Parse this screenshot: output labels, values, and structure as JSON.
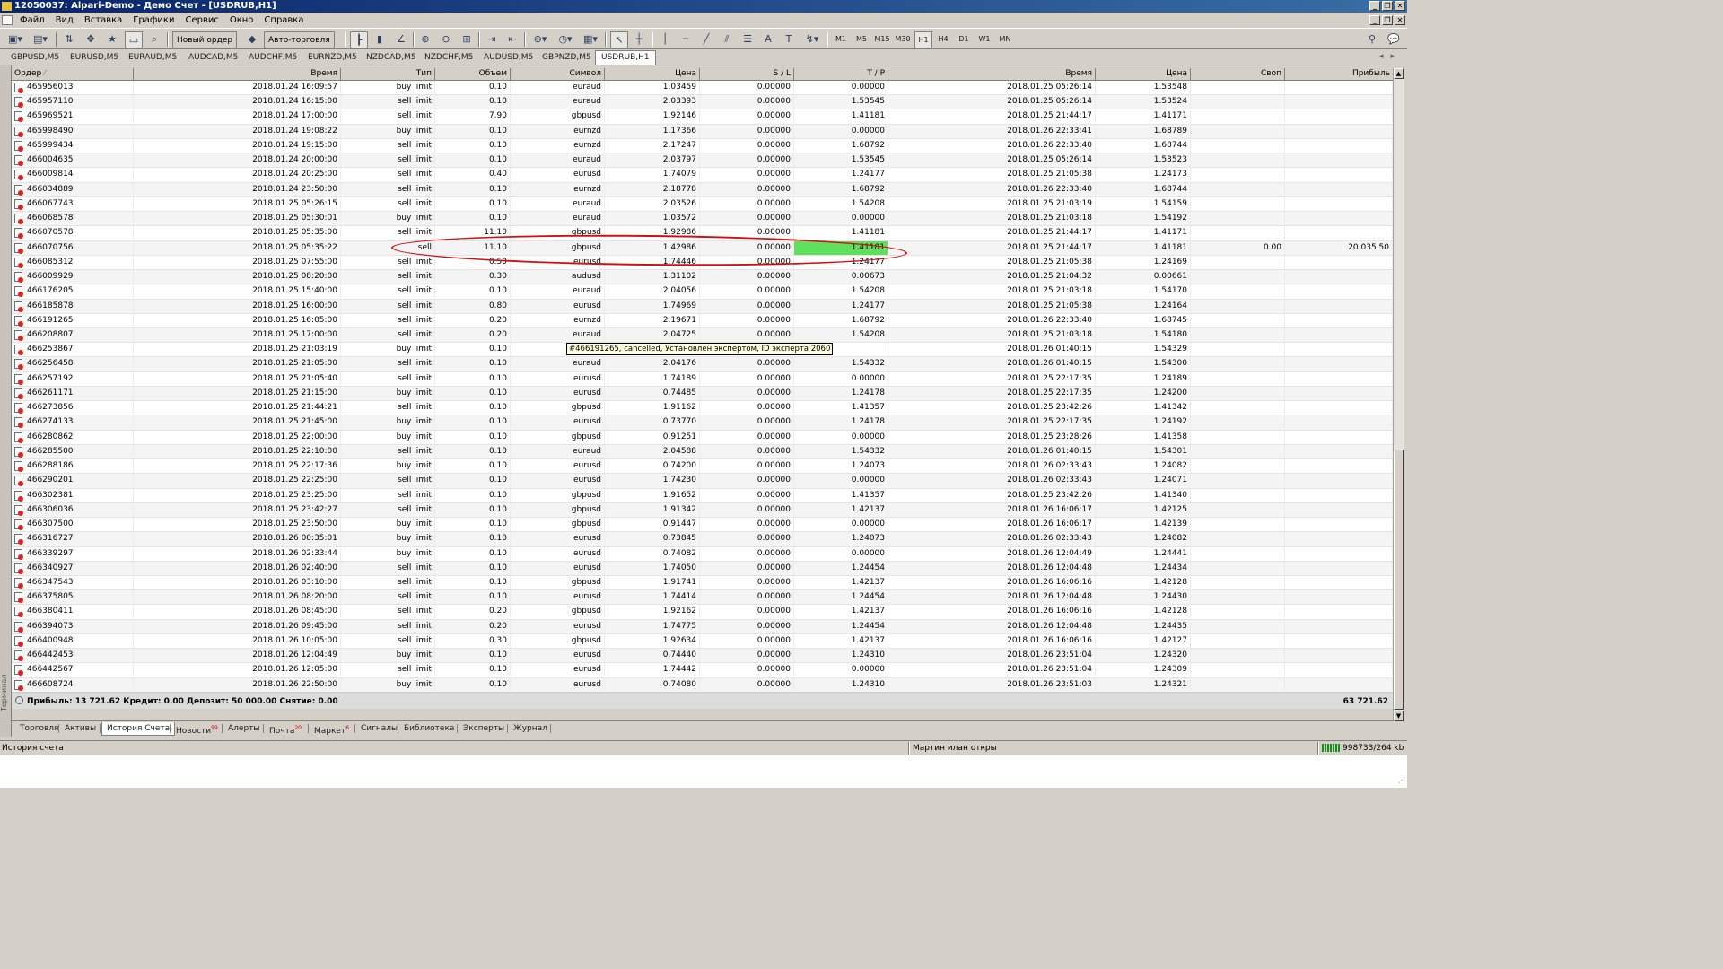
{
  "window": {
    "title": "12050037: Alpari-Demo - Демо Счет - [USDRUB,H1]"
  },
  "menu": [
    "Файл",
    "Вид",
    "Вставка",
    "Графики",
    "Сервис",
    "Окно",
    "Справка"
  ],
  "toolbar": {
    "new_order_label": "Новый ордер",
    "autotrade_label": "Авто-торговля",
    "timeframes": [
      "M1",
      "M5",
      "M15",
      "M30",
      "H1",
      "H4",
      "D1",
      "W1",
      "MN"
    ],
    "active_timeframe": "H1"
  },
  "chart_tabs": [
    "GBPUSD,M5",
    "EURUSD,M5",
    "EURAUD,M5",
    "AUDCAD,M5",
    "AUDCHF,M5",
    "EURNZD,M5",
    "NZDCAD,M5",
    "NZDCHF,M5",
    "AUDUSD,M5",
    "GBPNZD,M5",
    "USDRUB,H1"
  ],
  "active_chart_tab": "USDRUB,H1",
  "columns": [
    "Ордер",
    "Время",
    "Тип",
    "Объем",
    "Символ",
    "Цена",
    "S / L",
    "T / P",
    "Время",
    "Цена",
    "Своп",
    "Прибыль"
  ],
  "rows": [
    [
      "465956013",
      "2018.01.24 16:09:57",
      "buy limit",
      "0.10",
      "euraud",
      "1.03459",
      "0.00000",
      "0.00000",
      "2018.01.25 05:26:14",
      "1.53548",
      "",
      ""
    ],
    [
      "465957110",
      "2018.01.24 16:15:00",
      "sell limit",
      "0.10",
      "euraud",
      "2.03393",
      "0.00000",
      "1.53545",
      "2018.01.25 05:26:14",
      "1.53524",
      "",
      ""
    ],
    [
      "465969521",
      "2018.01.24 17:00:00",
      "sell limit",
      "7.90",
      "gbpusd",
      "1.92146",
      "0.00000",
      "1.41181",
      "2018.01.25 21:44:17",
      "1.41171",
      "",
      ""
    ],
    [
      "465998490",
      "2018.01.24 19:08:22",
      "buy limit",
      "0.10",
      "eurnzd",
      "1.17366",
      "0.00000",
      "0.00000",
      "2018.01.26 22:33:41",
      "1.68789",
      "",
      ""
    ],
    [
      "465999434",
      "2018.01.24 19:15:00",
      "sell limit",
      "0.10",
      "eurnzd",
      "2.17247",
      "0.00000",
      "1.68792",
      "2018.01.26 22:33:40",
      "1.68744",
      "",
      ""
    ],
    [
      "466004635",
      "2018.01.24 20:00:00",
      "sell limit",
      "0.10",
      "euraud",
      "2.03797",
      "0.00000",
      "1.53545",
      "2018.01.25 05:26:14",
      "1.53523",
      "",
      ""
    ],
    [
      "466009814",
      "2018.01.24 20:25:00",
      "sell limit",
      "0.40",
      "eurusd",
      "1.74079",
      "0.00000",
      "1.24177",
      "2018.01.25 21:05:38",
      "1.24173",
      "",
      ""
    ],
    [
      "466034889",
      "2018.01.24 23:50:00",
      "sell limit",
      "0.10",
      "eurnzd",
      "2.18778",
      "0.00000",
      "1.68792",
      "2018.01.26 22:33:40",
      "1.68744",
      "",
      ""
    ],
    [
      "466067743",
      "2018.01.25 05:26:15",
      "sell limit",
      "0.10",
      "euraud",
      "2.03526",
      "0.00000",
      "1.54208",
      "2018.01.25 21:03:19",
      "1.54159",
      "",
      ""
    ],
    [
      "466068578",
      "2018.01.25 05:30:01",
      "buy limit",
      "0.10",
      "euraud",
      "1.03572",
      "0.00000",
      "0.00000",
      "2018.01.25 21:03:18",
      "1.54192",
      "",
      ""
    ],
    [
      "466070578",
      "2018.01.25 05:35:00",
      "sell limit",
      "11.10",
      "gbpusd",
      "1.92986",
      "0.00000",
      "1.41181",
      "2018.01.25 21:44:17",
      "1.41171",
      "",
      ""
    ],
    [
      "466070756",
      "2018.01.25 05:35:22",
      "sell",
      "11.10",
      "gbpusd",
      "1.42986",
      "0.00000",
      "1.41181",
      "2018.01.25 21:44:17",
      "1.41181",
      "0.00",
      "20 035.50"
    ],
    [
      "466085312",
      "2018.01.25 07:55:00",
      "sell limit",
      "0.50",
      "eurusd",
      "1.74446",
      "0.00000",
      "1.24177",
      "2018.01.25 21:05:38",
      "1.24169",
      "",
      ""
    ],
    [
      "466009929",
      "2018.01.25 08:20:00",
      "sell limit",
      "0.30",
      "audusd",
      "1.31102",
      "0.00000",
      "0.00673",
      "2018.01.25 21:04:32",
      "0.00661",
      "",
      ""
    ],
    [
      "466176205",
      "2018.01.25 15:40:00",
      "sell limit",
      "0.10",
      "euraud",
      "2.04056",
      "0.00000",
      "1.54208",
      "2018.01.25 21:03:18",
      "1.54170",
      "",
      ""
    ],
    [
      "466185878",
      "2018.01.25 16:00:00",
      "sell limit",
      "0.80",
      "eurusd",
      "1.74969",
      "0.00000",
      "1.24177",
      "2018.01.25 21:05:38",
      "1.24164",
      "",
      ""
    ],
    [
      "466191265",
      "2018.01.25 16:05:00",
      "sell limit",
      "0.20",
      "eurnzd",
      "2.19671",
      "0.00000",
      "1.68792",
      "2018.01.26 22:33:40",
      "1.68745",
      "",
      ""
    ],
    [
      "466208807",
      "2018.01.25 17:00:00",
      "sell limit",
      "0.20",
      "euraud",
      "2.04725",
      "0.00000",
      "1.54208",
      "2018.01.25 21:03:18",
      "1.54180",
      "",
      ""
    ],
    [
      "466253867",
      "2018.01.25 21:03:19",
      "buy limit",
      "0.10",
      "",
      "",
      "",
      "",
      "2018.01.26 01:40:15",
      "1.54329",
      "",
      ""
    ],
    [
      "466256458",
      "2018.01.25 21:05:00",
      "sell limit",
      "0.10",
      "euraud",
      "2.04176",
      "0.00000",
      "1.54332",
      "2018.01.26 01:40:15",
      "1.54300",
      "",
      ""
    ],
    [
      "466257192",
      "2018.01.25 21:05:40",
      "sell limit",
      "0.10",
      "eurusd",
      "1.74189",
      "0.00000",
      "0.00000",
      "2018.01.25 22:17:35",
      "1.24189",
      "",
      ""
    ],
    [
      "466261171",
      "2018.01.25 21:15:00",
      "buy limit",
      "0.10",
      "eurusd",
      "0.74485",
      "0.00000",
      "1.24178",
      "2018.01.25 22:17:35",
      "1.24200",
      "",
      ""
    ],
    [
      "466273856",
      "2018.01.25 21:44:21",
      "sell limit",
      "0.10",
      "gbpusd",
      "1.91162",
      "0.00000",
      "1.41357",
      "2018.01.25 23:42:26",
      "1.41342",
      "",
      ""
    ],
    [
      "466274133",
      "2018.01.25 21:45:00",
      "buy limit",
      "0.10",
      "eurusd",
      "0.73770",
      "0.00000",
      "1.24178",
      "2018.01.25 22:17:35",
      "1.24192",
      "",
      ""
    ],
    [
      "466280862",
      "2018.01.25 22:00:00",
      "buy limit",
      "0.10",
      "gbpusd",
      "0.91251",
      "0.00000",
      "0.00000",
      "2018.01.25 23:28:26",
      "1.41358",
      "",
      ""
    ],
    [
      "466285500",
      "2018.01.25 22:10:00",
      "sell limit",
      "0.10",
      "euraud",
      "2.04588",
      "0.00000",
      "1.54332",
      "2018.01.26 01:40:15",
      "1.54301",
      "",
      ""
    ],
    [
      "466288186",
      "2018.01.25 22:17:36",
      "buy limit",
      "0.10",
      "eurusd",
      "0.74200",
      "0.00000",
      "1.24073",
      "2018.01.26 02:33:43",
      "1.24082",
      "",
      ""
    ],
    [
      "466290201",
      "2018.01.25 22:25:00",
      "sell limit",
      "0.10",
      "eurusd",
      "1.74230",
      "0.00000",
      "0.00000",
      "2018.01.26 02:33:43",
      "1.24071",
      "",
      ""
    ],
    [
      "466302381",
      "2018.01.25 23:25:00",
      "sell limit",
      "0.10",
      "gbpusd",
      "1.91652",
      "0.00000",
      "1.41357",
      "2018.01.25 23:42:26",
      "1.41340",
      "",
      ""
    ],
    [
      "466306036",
      "2018.01.25 23:42:27",
      "sell limit",
      "0.10",
      "gbpusd",
      "1.91342",
      "0.00000",
      "1.42137",
      "2018.01.26 16:06:17",
      "1.42125",
      "",
      ""
    ],
    [
      "466307500",
      "2018.01.25 23:50:00",
      "buy limit",
      "0.10",
      "gbpusd",
      "0.91447",
      "0.00000",
      "0.00000",
      "2018.01.26 16:06:17",
      "1.42139",
      "",
      ""
    ],
    [
      "466316727",
      "2018.01.26 00:35:01",
      "buy limit",
      "0.10",
      "eurusd",
      "0.73845",
      "0.00000",
      "1.24073",
      "2018.01.26 02:33:43",
      "1.24082",
      "",
      ""
    ],
    [
      "466339297",
      "2018.01.26 02:33:44",
      "buy limit",
      "0.10",
      "eurusd",
      "0.74082",
      "0.00000",
      "0.00000",
      "2018.01.26 12:04:49",
      "1.24441",
      "",
      ""
    ],
    [
      "466340927",
      "2018.01.26 02:40:00",
      "sell limit",
      "0.10",
      "eurusd",
      "1.74050",
      "0.00000",
      "1.24454",
      "2018.01.26 12:04:48",
      "1.24434",
      "",
      ""
    ],
    [
      "466347543",
      "2018.01.26 03:10:00",
      "sell limit",
      "0.10",
      "gbpusd",
      "1.91741",
      "0.00000",
      "1.42137",
      "2018.01.26 16:06:16",
      "1.42128",
      "",
      ""
    ],
    [
      "466375805",
      "2018.01.26 08:20:00",
      "sell limit",
      "0.10",
      "eurusd",
      "1.74414",
      "0.00000",
      "1.24454",
      "2018.01.26 12:04:48",
      "1.24430",
      "",
      ""
    ],
    [
      "466380411",
      "2018.01.26 08:45:00",
      "sell limit",
      "0.20",
      "gbpusd",
      "1.92162",
      "0.00000",
      "1.42137",
      "2018.01.26 16:06:16",
      "1.42128",
      "",
      ""
    ],
    [
      "466394073",
      "2018.01.26 09:45:00",
      "sell limit",
      "0.20",
      "eurusd",
      "1.74775",
      "0.00000",
      "1.24454",
      "2018.01.26 12:04:48",
      "1.24435",
      "",
      ""
    ],
    [
      "466400948",
      "2018.01.26 10:05:00",
      "sell limit",
      "0.30",
      "gbpusd",
      "1.92634",
      "0.00000",
      "1.42137",
      "2018.01.26 16:06:16",
      "1.42127",
      "",
      ""
    ],
    [
      "466442453",
      "2018.01.26 12:04:49",
      "buy limit",
      "0.10",
      "eurusd",
      "0.74440",
      "0.00000",
      "1.24310",
      "2018.01.26 23:51:04",
      "1.24320",
      "",
      ""
    ],
    [
      "466442567",
      "2018.01.26 12:05:00",
      "sell limit",
      "0.10",
      "eurusd",
      "1.74442",
      "0.00000",
      "0.00000",
      "2018.01.26 23:51:04",
      "1.24309",
      "",
      ""
    ],
    [
      "466608724",
      "2018.01.26 22:50:00",
      "buy limit",
      "0.10",
      "eurusd",
      "0.74080",
      "0.00000",
      "1.24310",
      "2018.01.26 23:51:03",
      "1.24321",
      "",
      ""
    ]
  ],
  "highlight_row_index": 11,
  "highlight_color": "#5ee05e",
  "annotation_color": "#d11111",
  "tooltip": "#466191265, cancelled, Установлен экспертом, ID эксперта 2060",
  "summary": {
    "text": "Прибыль: 13 721.62  Кредит: 0.00  Депозит: 50 000.00  Снятие: 0.00",
    "total": "63 721.62"
  },
  "terminal_label": "Терминал",
  "bottom_tabs": [
    {
      "label": "Торговля",
      "badge": ""
    },
    {
      "label": "Активы",
      "badge": ""
    },
    {
      "label": "История Счета",
      "badge": ""
    },
    {
      "label": "Новости",
      "badge": "99"
    },
    {
      "label": "Алерты",
      "badge": ""
    },
    {
      "label": "Почта",
      "badge": "20"
    },
    {
      "label": "Маркет",
      "badge": "6"
    },
    {
      "label": "Сигналы",
      "badge": ""
    },
    {
      "label": "Библиотека",
      "badge": ""
    },
    {
      "label": "Эксперты",
      "badge": ""
    },
    {
      "label": "Журнал",
      "badge": ""
    }
  ],
  "active_bottom_tab": "История Счета",
  "status": {
    "left": "История счета",
    "middle": "Мартин илан откры",
    "right": "998733/264 kb"
  }
}
